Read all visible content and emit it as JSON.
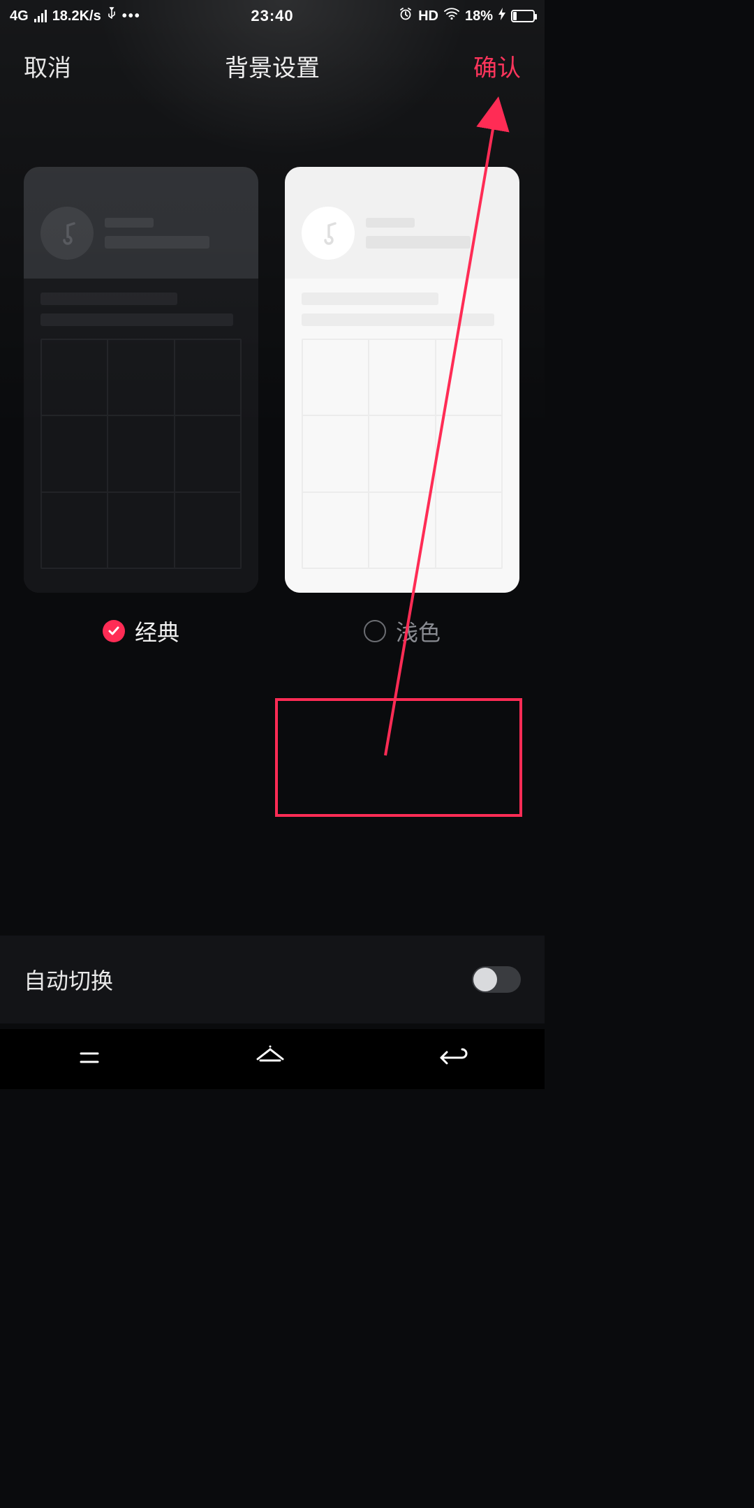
{
  "status": {
    "network": "4G",
    "speed": "18.2K/s",
    "time": "23:40",
    "hd": "HD",
    "battery_pct": "18%"
  },
  "header": {
    "cancel": "取消",
    "title": "背景设置",
    "confirm": "确认"
  },
  "themes": {
    "classic_label": "经典",
    "light_label": "浅色",
    "selected": "classic"
  },
  "auto_switch": {
    "label": "自动切换",
    "enabled": false
  },
  "colors": {
    "accent": "#ff2c55"
  }
}
